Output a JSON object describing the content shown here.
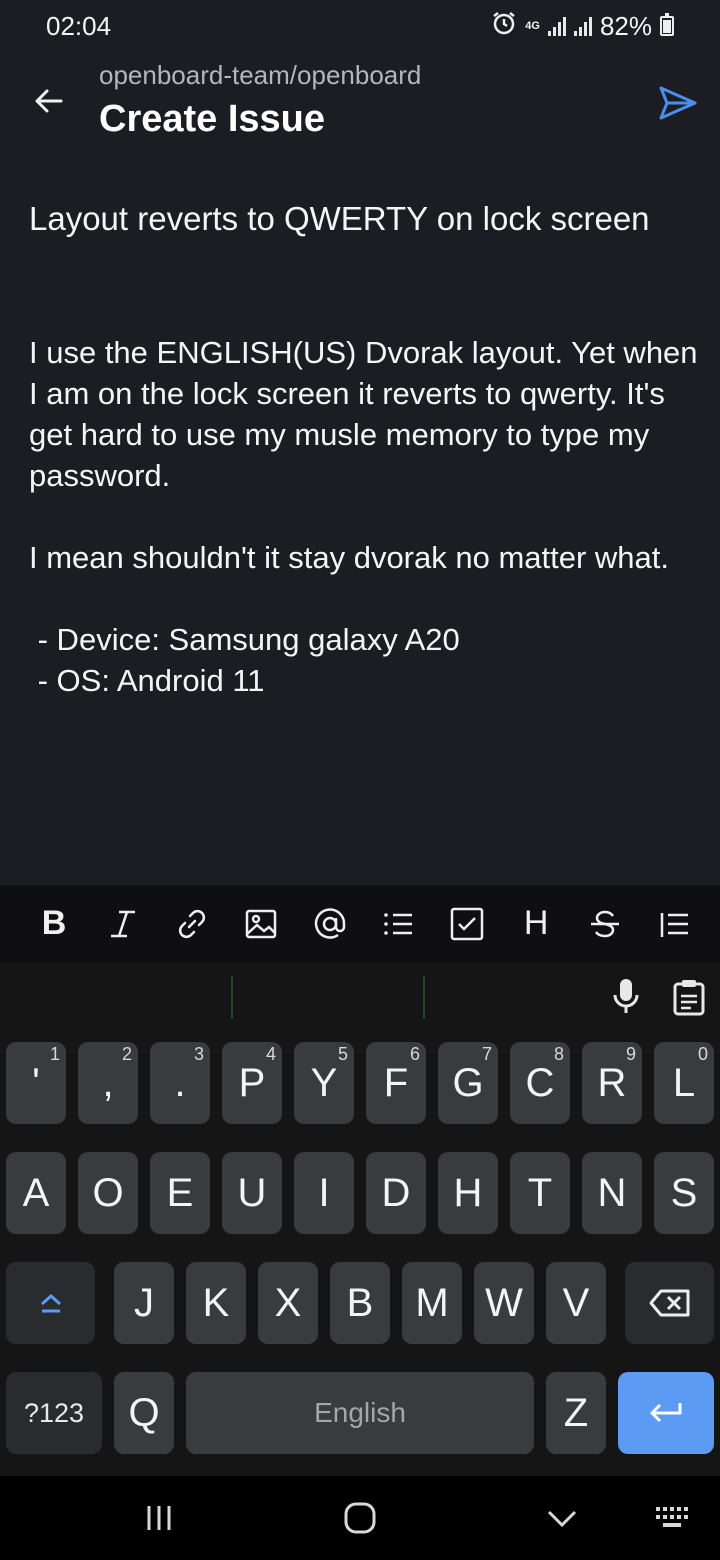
{
  "status": {
    "time": "02:04",
    "network": "4G",
    "battery": "82%"
  },
  "header": {
    "repo": "openboard-team/openboard",
    "title": "Create Issue"
  },
  "issue": {
    "title": "Layout reverts to QWERTY on lock screen",
    "body_line1": "I use the ENGLISH(US) Dvorak layout. Yet when I am on the lock screen it reverts to qwerty. It's get hard to use my musle memory to type my password.",
    "body_line2": "I mean shouldn't it stay dvorak no matter what.",
    "body_list1": " - Device: Samsung galaxy A20",
    "body_list2": " - OS: Android 11"
  },
  "toolbar": {
    "bold": "B",
    "heading": "H",
    "icons": [
      "bold-icon",
      "italic-icon",
      "link-icon",
      "image-icon",
      "mention-icon",
      "list-icon",
      "checkbox-icon",
      "heading-icon",
      "strikethrough-icon",
      "ordered-list-icon"
    ]
  },
  "keyboard": {
    "row1": [
      {
        "label": "'",
        "hint": "1"
      },
      {
        "label": ",",
        "hint": "2"
      },
      {
        "label": ".",
        "hint": "3"
      },
      {
        "label": "P",
        "hint": "4"
      },
      {
        "label": "Y",
        "hint": "5"
      },
      {
        "label": "F",
        "hint": "6"
      },
      {
        "label": "G",
        "hint": "7"
      },
      {
        "label": "C",
        "hint": "8"
      },
      {
        "label": "R",
        "hint": "9"
      },
      {
        "label": "L",
        "hint": "0"
      }
    ],
    "row2": [
      "A",
      "O",
      "E",
      "U",
      "I",
      "D",
      "H",
      "T",
      "N",
      "S"
    ],
    "row3": [
      "J",
      "K",
      "X",
      "B",
      "M",
      "W",
      "V"
    ],
    "mode_key": "?123",
    "q_key": "Q",
    "space": "English",
    "z_key": "Z",
    "accent_color": "#5b9bf3"
  }
}
